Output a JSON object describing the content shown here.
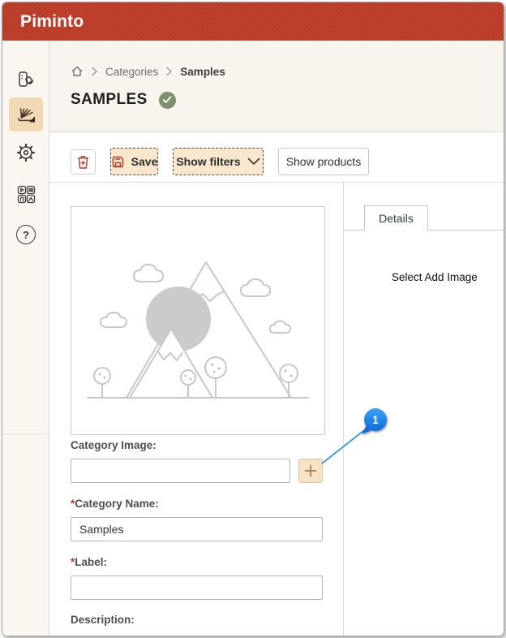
{
  "app": {
    "title": "Piminto"
  },
  "sidebar": {
    "help_glyph": "?",
    "items": [
      {
        "name": "catalog",
        "icon": "catalog-icon",
        "active": false
      },
      {
        "name": "categories",
        "icon": "categories-icon",
        "active": true
      },
      {
        "name": "settings",
        "icon": "gear-icon",
        "active": false
      },
      {
        "name": "media",
        "icon": "media-grid-icon",
        "active": false
      },
      {
        "name": "help",
        "icon": "help-icon",
        "active": false
      }
    ]
  },
  "breadcrumb": {
    "items": [
      {
        "label": "Categories"
      },
      {
        "label": "Samples"
      }
    ]
  },
  "page": {
    "title": "SAMPLES"
  },
  "toolbar": {
    "save_label": "Save",
    "show_filters_label": "Show filters",
    "show_products_label": "Show products"
  },
  "form": {
    "category_image": {
      "label": "Category Image:",
      "value": ""
    },
    "category_name": {
      "label": "Category Name:",
      "required_mark": "*",
      "value": "Samples"
    },
    "label_field": {
      "label": "Label:",
      "required_mark": "*",
      "value": ""
    },
    "description": {
      "label": "Description:"
    }
  },
  "details_panel": {
    "tab_label": "Details"
  },
  "callout": {
    "number": "1",
    "text": "Select Add Image"
  },
  "colors": {
    "brand_red": "#b93a27",
    "highlight_tan": "#f1d9b5",
    "button_tan": "#f8e7cd",
    "icon_maroon": "#a63e2a",
    "badge_green": "#7e8f6e",
    "callout_blue": "#1877e6"
  }
}
